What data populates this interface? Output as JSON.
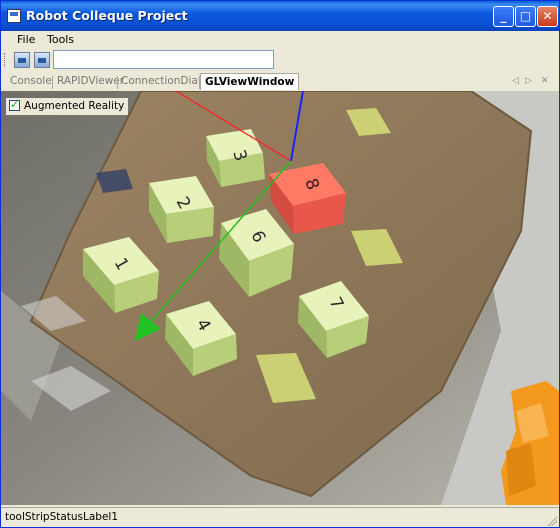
{
  "window": {
    "title": "Robot Colleque Project",
    "controls": {
      "minimize": "_",
      "maximize": "□",
      "close": "✕"
    }
  },
  "menubar": {
    "items": [
      "File",
      "Tools"
    ]
  },
  "toolbar": {
    "buttons": [
      "image-icon",
      "image-icon"
    ],
    "input_value": ""
  },
  "tabs": {
    "items": [
      {
        "label": "Console",
        "active": false
      },
      {
        "label": "RAPIDViewer",
        "active": false
      },
      {
        "label": "ConnectionDialog",
        "active": false
      },
      {
        "label": "GLViewWindow",
        "active": true
      }
    ],
    "nav": {
      "left": "◁",
      "right": "▷",
      "close": "✕"
    }
  },
  "viewport": {
    "augmented_reality": {
      "label": "Augmented Reality",
      "checked": true
    },
    "blocks": [
      "3",
      "8",
      "2",
      "6",
      "1",
      "4",
      "7"
    ],
    "colors": {
      "block": "#cfe3a1",
      "highlight": "#ff6a55",
      "x_axis": "#ff2020",
      "y_axis": "#22c322",
      "z_axis": "#1a22ff"
    }
  },
  "statusbar": {
    "label": "toolStripStatusLabel1"
  }
}
